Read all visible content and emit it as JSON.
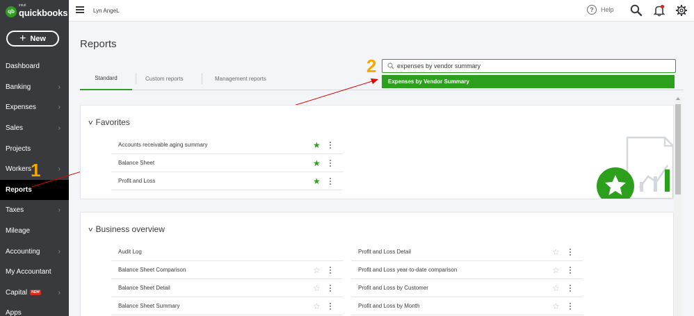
{
  "brand": {
    "logo_mark": "qb",
    "intuit": "intuit",
    "name": "quickbooks"
  },
  "sidebar": {
    "new_label": "New",
    "items": [
      {
        "label": "Dashboard",
        "chevron": false
      },
      {
        "label": "Banking",
        "chevron": true
      },
      {
        "label": "Expenses",
        "chevron": true
      },
      {
        "label": "Sales",
        "chevron": true
      },
      {
        "label": "Projects",
        "chevron": false
      },
      {
        "label": "Workers",
        "chevron": true
      },
      {
        "label": "Reports",
        "chevron": false,
        "active": true
      },
      {
        "label": "Taxes",
        "chevron": true
      },
      {
        "label": "Mileage",
        "chevron": false
      },
      {
        "label": "Accounting",
        "chevron": true
      },
      {
        "label": "My Accountant",
        "chevron": false
      },
      {
        "label": "Capital",
        "chevron": true,
        "badge": "NEW"
      },
      {
        "label": "Apps",
        "chevron": false
      }
    ]
  },
  "header": {
    "company": "Lyn AngeL",
    "help": "Help"
  },
  "page": {
    "title": "Reports",
    "tabs": [
      "Standard",
      "Custom reports",
      "Management reports"
    ],
    "search_value": "expenses by vendor summary",
    "suggestion": "Expenses by Vendor Summary"
  },
  "annotations": {
    "step1": "1",
    "step2": "2"
  },
  "favorites": {
    "title": "Favorites",
    "rows": [
      {
        "label": "Accounts receivable aging summary"
      },
      {
        "label": "Balance Sheet"
      },
      {
        "label": "Profit and Loss"
      }
    ]
  },
  "business_overview": {
    "title": "Business overview",
    "left": [
      {
        "label": "Audit Log",
        "star": false
      },
      {
        "label": "Balance Sheet Comparison",
        "star": true
      },
      {
        "label": "Balance Sheet Detail",
        "star": true
      },
      {
        "label": "Balance Sheet Summary",
        "star": true
      }
    ],
    "right": [
      {
        "label": "Profit and Loss Detail"
      },
      {
        "label": "Profit and Loss year-to-date comparison"
      },
      {
        "label": "Profit and Loss by Customer"
      },
      {
        "label": "Profit and Loss by Month"
      }
    ]
  },
  "colors": {
    "accent": "#2ca01c",
    "sidebar": "#393a3d",
    "annotation": "#f5a800",
    "arrow": "#e00000"
  }
}
